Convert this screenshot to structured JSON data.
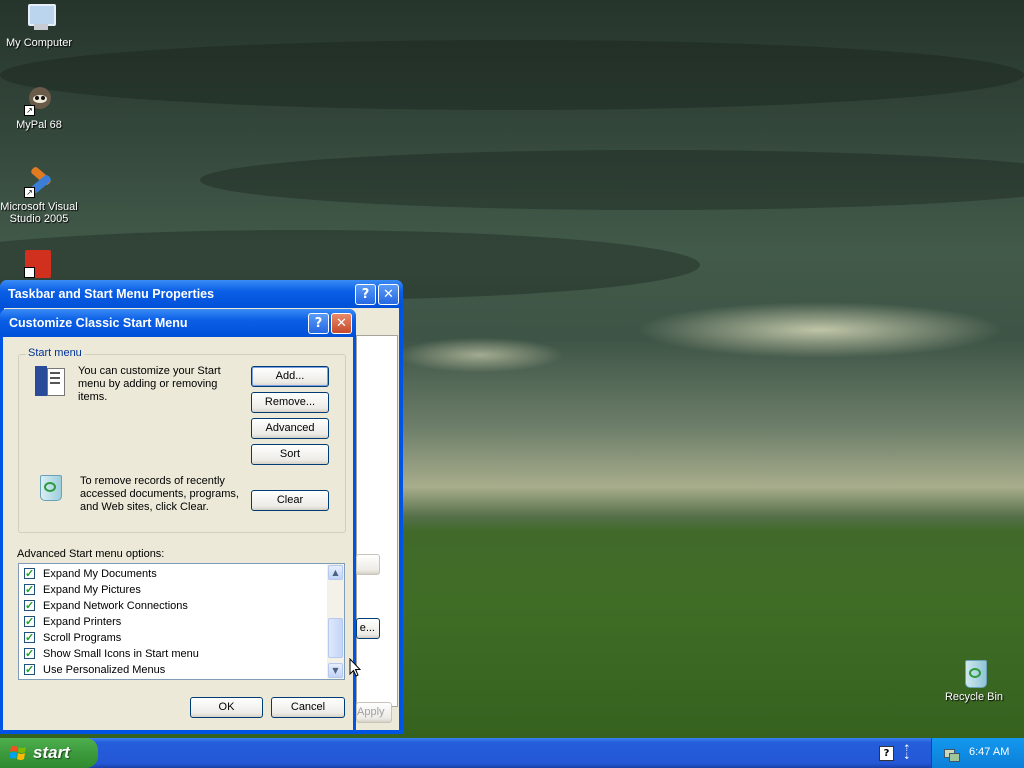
{
  "desktop": {
    "icons": [
      {
        "label": "My Computer",
        "icon": "my-computer-icon"
      },
      {
        "label": "MyPal 68",
        "icon": "mypal-icon"
      },
      {
        "label_line1": "Microsoft Visual",
        "label_line2": "Studio 2005",
        "icon": "visual-studio-icon"
      },
      {
        "label": "Recycle Bin",
        "icon": "recycle-bin-icon"
      }
    ]
  },
  "back_window": {
    "title": "Taskbar and Start Menu Properties",
    "apply_label": "Apply",
    "partial_button_label": "e..."
  },
  "dialog": {
    "title": "Customize Classic Start Menu",
    "group_label": "Start menu",
    "intro_line1": "You can customize your Start",
    "intro_line2": "menu by adding or removing",
    "intro_line3": "items.",
    "add_label": "Add...",
    "remove_label": "Remove...",
    "advanced_label": "Advanced",
    "sort_label": "Sort",
    "clear_text_line1": "To remove records of recently",
    "clear_text_line2": "accessed documents, programs,",
    "clear_text_line3": "and Web sites, click Clear.",
    "clear_label": "Clear",
    "options_label": "Advanced Start menu options:",
    "options": [
      {
        "label": "Expand My Documents",
        "checked": true
      },
      {
        "label": "Expand My Pictures",
        "checked": true
      },
      {
        "label": "Expand Network Connections",
        "checked": true
      },
      {
        "label": "Expand Printers",
        "checked": true
      },
      {
        "label": "Scroll Programs",
        "checked": true
      },
      {
        "label": "Show Small Icons in Start menu",
        "checked": true
      },
      {
        "label": "Use Personalized Menus",
        "checked": true
      }
    ],
    "ok_label": "OK",
    "cancel_label": "Cancel"
  },
  "taskbar": {
    "start_label": "start",
    "clock": "6:47 AM"
  },
  "colors": {
    "titlebar_blue": "#0054e3",
    "dialog_bg": "#ece9d8",
    "start_green": "#3c9a3c",
    "taskbar_blue": "#245edb"
  }
}
